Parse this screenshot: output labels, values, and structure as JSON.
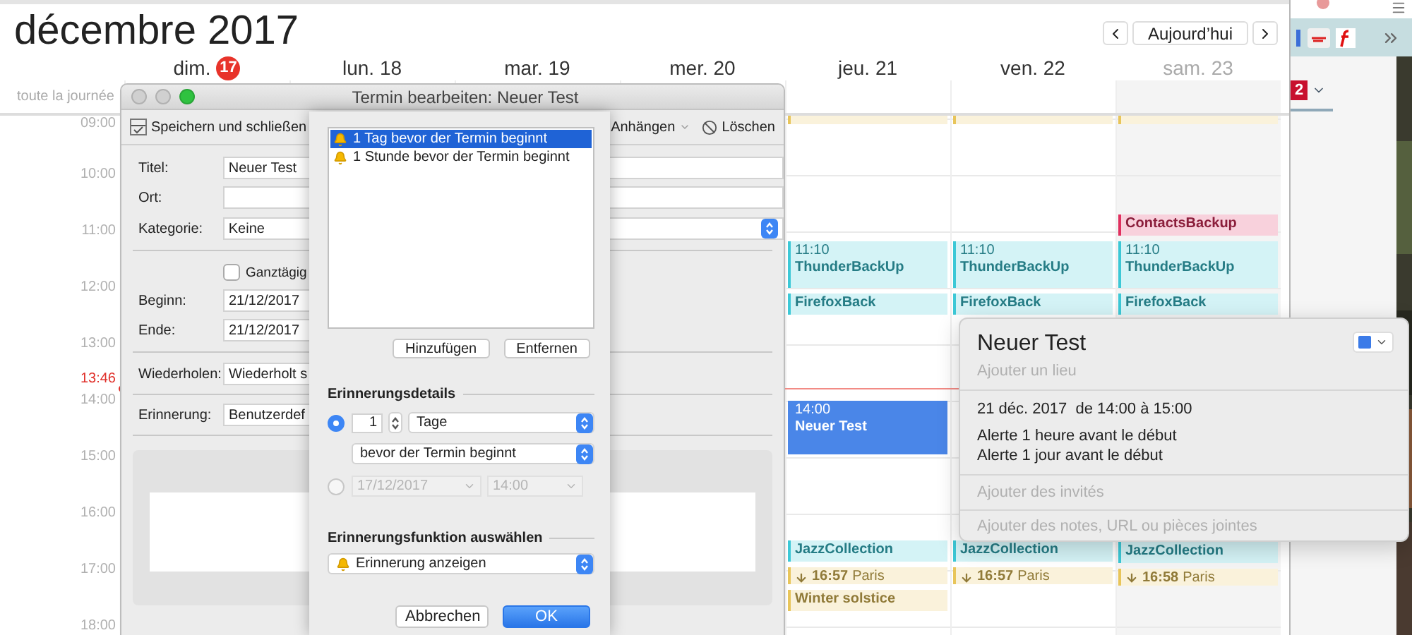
{
  "calendar": {
    "title": "décembre 2017",
    "today_button": "Aujourd’hui",
    "all_day_label": "toute la journée",
    "now": {
      "time": "13:46"
    },
    "hours": [
      "09:00",
      "10:00",
      "11:00",
      "12:00",
      "13:00",
      "14:00",
      "15:00",
      "16:00",
      "17:00",
      "18:00"
    ],
    "days": [
      {
        "weekday": "dim.",
        "date": "17",
        "today": true,
        "dimmed": false
      },
      {
        "weekday": "lun.",
        "date": "18",
        "today": false,
        "dimmed": false
      },
      {
        "weekday": "mar.",
        "date": "19",
        "today": false,
        "dimmed": false
      },
      {
        "weekday": "mer.",
        "date": "20",
        "today": false,
        "dimmed": false
      },
      {
        "weekday": "jeu.",
        "date": "21",
        "today": false,
        "dimmed": false,
        "events": [
          {
            "kind": "sunrise",
            "color": "#e8c55a",
            "selected": false
          },
          {
            "kind": "event",
            "start": "11:10",
            "title": "ThunderBackUp",
            "color": "#3cc8d6",
            "selected": false,
            "after": [
              {
                "title": "FirefoxBack",
                "color": "#3cc8d6",
                "selected": false
              }
            ]
          },
          {
            "kind": "event",
            "start": "14:00",
            "title": "Neuer Test",
            "color": "#4a86e8",
            "selected": true
          },
          {
            "kind": "sun",
            "start": "16:57",
            "place": "Paris",
            "color": "#e8c55a",
            "selected": false,
            "before": [
              {
                "title": "JazzCollection",
                "color": "#3cc8d6",
                "selected": false
              }
            ],
            "after": [
              {
                "title": "Winter solstice",
                "color": "#e8c55a",
                "selected": false
              }
            ]
          }
        ]
      },
      {
        "weekday": "ven.",
        "date": "22",
        "today": false,
        "dimmed": false,
        "events": [
          {
            "kind": "sunrise",
            "color": "#e8c55a",
            "selected": false
          },
          {
            "kind": "event",
            "start": "11:10",
            "title": "ThunderBackUp",
            "color": "#3cc8d6",
            "selected": false,
            "after": [
              {
                "title": "FirefoxBack",
                "color": "#3cc8d6",
                "selected": false
              }
            ]
          },
          {
            "kind": "sun",
            "start": "16:57",
            "place": "Paris",
            "color": "#e8c55a",
            "selected": false,
            "before": [
              {
                "title": "JazzCollection",
                "color": "#3cc8d6",
                "selected": false
              }
            ]
          }
        ]
      },
      {
        "weekday": "sam.",
        "date": "23",
        "today": false,
        "dimmed": true,
        "events": [
          {
            "kind": "sunrise",
            "color": "#e8c55a",
            "selected": false
          },
          {
            "kind": "event",
            "start": "11:10",
            "title": "ThunderBackUp",
            "color": "#3cc8d6",
            "selected": false,
            "before": [
              {
                "title": "ContactsBackup",
                "color": "#e0305f",
                "selected": false
              }
            ],
            "after": [
              {
                "title": "FirefoxBack",
                "color": "#3cc8d6",
                "selected": false
              }
            ]
          },
          {
            "kind": "sun",
            "start": "16:58",
            "place": "Paris",
            "color": "#e8c55a",
            "selected": false,
            "before": [
              {
                "title": "JazzCollection",
                "color": "#3cc8d6",
                "selected": false
              }
            ]
          }
        ]
      }
    ]
  },
  "side_window": {
    "badge": "2"
  },
  "dialog": {
    "title": "Termin bearbeiten: Neuer Test",
    "toolbar": {
      "save": "Speichern und schließen",
      "attach": "Anhängen",
      "delete": "Löschen"
    },
    "form": {
      "title_label": "Titel:",
      "title_value": "Neuer Test",
      "location_label": "Ort:",
      "category_label": "Kategorie:",
      "category_value": "Keine",
      "all_day": {
        "label": "Ganztägig",
        "checked": false
      },
      "start_label": "Beginn:",
      "start_value": "21/12/2017",
      "end_label": "Ende:",
      "end_value": "21/12/2017",
      "repeat_label": "Wiederholen:",
      "repeat_value": "Wiederholt s",
      "reminder_label": "Erinnerung:",
      "reminder_value": "Benutzerdef"
    },
    "reminder_sheet": {
      "reminders": [
        {
          "text": "1 Tag bevor der Termin beginnt",
          "selected": true
        },
        {
          "text": "1 Stunde bevor der Termin beginnt",
          "selected": false
        }
      ],
      "add_button": "Hinzufügen",
      "remove_button": "Entfernen",
      "details_heading": "Erinnerungsdetails",
      "options": [
        {
          "kind": "relative",
          "selected": true,
          "disabled": false,
          "amount": "1",
          "unit": "Tage",
          "relation": "bevor der Termin beginnt"
        },
        {
          "kind": "absolute",
          "selected": false,
          "disabled": true,
          "date": "17/12/2017",
          "time": "14:00"
        }
      ],
      "action_heading": "Erinnerungsfunktion auswählen",
      "action": "Erinnerung anzeigen",
      "cancel_button": "Abbrechen",
      "ok_button": "OK"
    }
  },
  "popover": {
    "title": "Neuer Test",
    "location_placeholder": "Ajouter un lieu",
    "color": "#3b7be8",
    "when": "21 déc. 2017  de 14:00 à 15:00",
    "alerts": [
      "Alerte 1 heure avant le début",
      "Alerte 1 jour avant le début"
    ],
    "invitees_placeholder": "Ajouter des invités",
    "notes_placeholder": "Ajouter des notes, URL ou pièces jointes"
  }
}
